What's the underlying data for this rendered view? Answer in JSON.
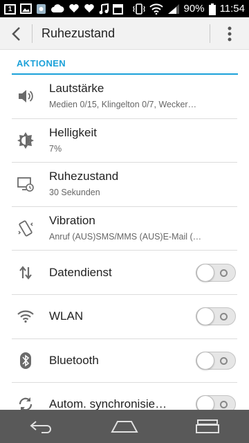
{
  "status_bar": {
    "notification_box": "1",
    "battery": "90%",
    "time": "11:54"
  },
  "action_bar": {
    "title": "Ruhezustand"
  },
  "section": {
    "title": "AKTIONEN"
  },
  "items": [
    {
      "title": "Lautstärke",
      "subtitle": "Medien 0/15, Klingelton 0/7, Wecker…"
    },
    {
      "title": "Helligkeit",
      "subtitle": "7%"
    },
    {
      "title": "Ruhezustand",
      "subtitle": "30 Sekunden"
    },
    {
      "title": "Vibration",
      "subtitle": "Anruf (AUS)SMS/MMS (AUS)E-Mail (…"
    },
    {
      "title": "Datendienst"
    },
    {
      "title": "WLAN"
    },
    {
      "title": "Bluetooth"
    },
    {
      "title": "Autom. synchronisie…"
    }
  ],
  "colors": {
    "accent": "#1ba1d9",
    "statusbar": "#000000",
    "navbar": "#595959"
  }
}
